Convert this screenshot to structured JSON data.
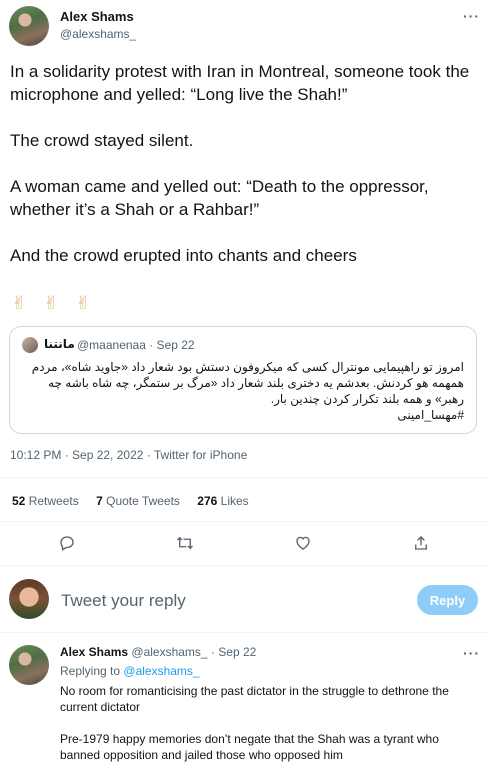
{
  "tweet": {
    "author_name": "Alex Shams",
    "author_handle": "@alexshams_",
    "more_icon": "ellipsis-icon",
    "text": [
      "In a solidarity protest with Iran in Montreal, someone took the microphone and yelled: “Long live the Shah!”",
      "The crowd stayed silent.",
      "A woman came and yelled out: “Death to the oppressor, whether it’s a Shah or a Rahbar!”",
      "And the crowd erupted into chants and cheers"
    ],
    "emoji": [
      "✌",
      "✌",
      "✌"
    ],
    "quote": {
      "author_name": "مانتنا",
      "author_handle": "@maanenaa · Sep 22",
      "text": "امروز تو راهپیمایی مونترال کسی که میکروفون دستش بود شعار داد «جاوید شاه»، مردم همهمه هو کردنش. بعدشم یه دختری بلند شعار داد «مرگ بر ستمگر، چه شاه باشه چه رهبر» و همه بلند تکرار کردن چندین بار.",
      "hashtag": "#مهسا_امینی"
    },
    "meta": "10:12 PM · Sep 22, 2022 · Twitter for iPhone",
    "stats": {
      "retweets_count": "52",
      "retweets_label": "Retweets",
      "quotes_count": "7",
      "quotes_label": "Quote Tweets",
      "likes_count": "276",
      "likes_label": "Likes"
    },
    "actions": [
      "reply-icon",
      "retweet-icon",
      "like-icon",
      "share-icon"
    ]
  },
  "composer": {
    "placeholder": "Tweet your reply",
    "reply_button": "Reply"
  },
  "reply": {
    "author_name": "Alex Shams",
    "author_handle": "@alexshams_",
    "date": "· Sep 22",
    "replying_prefix": "Replying to",
    "replying_to": "@alexshams_",
    "text": [
      "No room for romanticising the past dictator in the struggle to dethrone the current dictator",
      "Pre-1979 happy memories don’t negate that the Shah was a tyrant who banned opposition and jailed those who opposed him"
    ]
  },
  "colors": {
    "accent": "#1d9bf0",
    "reply_button_disabled": "#8ecdf8",
    "muted": "#536471"
  }
}
